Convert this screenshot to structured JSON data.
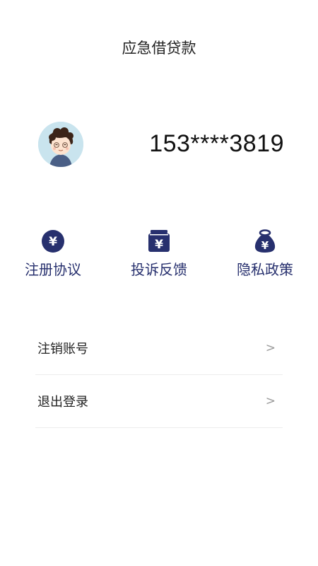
{
  "header": {
    "title": "应急借贷款"
  },
  "user": {
    "phone": "153****3819"
  },
  "actions": [
    {
      "label": "注册协议",
      "icon": "yen-circle-icon"
    },
    {
      "label": "投诉反馈",
      "icon": "yen-wallet-icon"
    },
    {
      "label": "隐私政策",
      "icon": "yen-money-bag-icon"
    }
  ],
  "menu": [
    {
      "label": "注销账号",
      "chevron": ">"
    },
    {
      "label": "退出登录",
      "chevron": ">"
    }
  ],
  "colors": {
    "accent": "#27306e",
    "divider": "#ececec",
    "avatar_bg": "#c9e4ee"
  }
}
